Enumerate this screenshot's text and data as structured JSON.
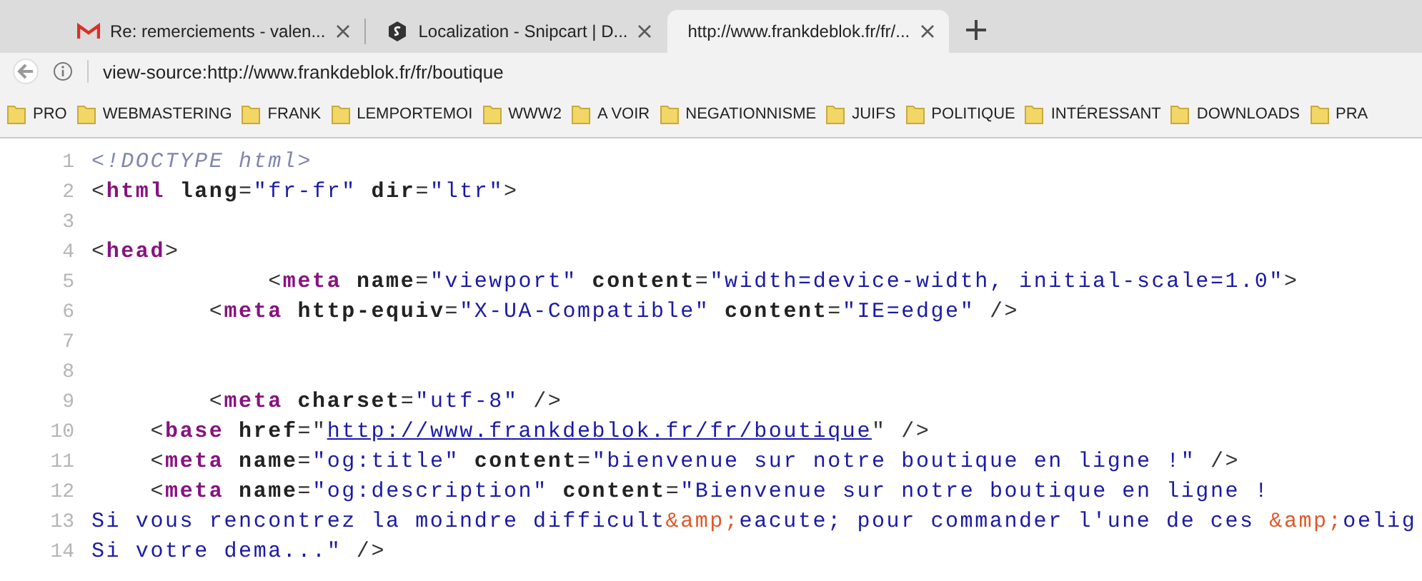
{
  "tabs": [
    {
      "title": "Re: remerciements - valen...",
      "kind": "mail",
      "selected": false
    },
    {
      "title": "Localization - Snipcart | D...",
      "kind": "hexagon",
      "selected": false
    },
    {
      "title": "http://www.frankdeblok.fr/fr/...",
      "kind": "plain",
      "selected": true
    }
  ],
  "address_bar": {
    "url": "view-source:http://www.frankdeblok.fr/fr/boutique"
  },
  "bookmarks": [
    "PRO",
    "WEBMASTERING",
    "FRANK",
    "LEMPORTEMOI",
    "WWW2",
    "A VOIR",
    "NEGATIONNISME",
    "JUIFS",
    "POLITIQUE",
    "INTÉRESSANT",
    "DOWNLOADS",
    "PRA"
  ],
  "source": {
    "lines": [
      {
        "number": "1",
        "tokens": [
          {
            "kind": "comment",
            "text": "<!DOCTYPE html>"
          }
        ]
      },
      {
        "number": "2",
        "tokens": [
          {
            "kind": "punct",
            "text": "<"
          },
          {
            "kind": "tag",
            "text": "html"
          },
          {
            "kind": "attr",
            "text": " lang"
          },
          {
            "kind": "punct",
            "text": "="
          },
          {
            "kind": "value",
            "text": "\"fr-fr\""
          },
          {
            "kind": "attr",
            "text": " dir"
          },
          {
            "kind": "punct",
            "text": "="
          },
          {
            "kind": "value",
            "text": "\"ltr\""
          },
          {
            "kind": "punct",
            "text": ">"
          }
        ]
      },
      {
        "number": "3"
      },
      {
        "number": "4",
        "tokens": [
          {
            "kind": "punct",
            "text": "<"
          },
          {
            "kind": "tag",
            "text": "head"
          },
          {
            "kind": "punct",
            "text": ">"
          }
        ]
      },
      {
        "number": "5",
        "tokens": [
          {
            "kind": "punct",
            "text": "            <"
          },
          {
            "kind": "tag",
            "text": "meta"
          },
          {
            "kind": "attr",
            "text": " name"
          },
          {
            "kind": "punct",
            "text": "="
          },
          {
            "kind": "value",
            "text": "\"viewport\""
          },
          {
            "kind": "attr",
            "text": " content"
          },
          {
            "kind": "punct",
            "text": "="
          },
          {
            "kind": "value",
            "text": "\"width=device-width, initial-scale=1.0\""
          },
          {
            "kind": "punct",
            "text": ">"
          }
        ]
      },
      {
        "number": "6",
        "tokens": [
          {
            "kind": "punct",
            "text": "        <"
          },
          {
            "kind": "tag",
            "text": "meta"
          },
          {
            "kind": "attr",
            "text": " http-equiv"
          },
          {
            "kind": "punct",
            "text": "="
          },
          {
            "kind": "value",
            "text": "\"X-UA-Compatible\""
          },
          {
            "kind": "attr",
            "text": " content"
          },
          {
            "kind": "punct",
            "text": "="
          },
          {
            "kind": "value",
            "text": "\"IE=edge\""
          },
          {
            "kind": "punct",
            "text": " />"
          }
        ]
      },
      {
        "number": "7"
      },
      {
        "number": "8"
      },
      {
        "number": "9",
        "tokens": [
          {
            "kind": "punct",
            "text": "        <"
          },
          {
            "kind": "tag",
            "text": "meta"
          },
          {
            "kind": "attr",
            "text": " charset"
          },
          {
            "kind": "punct",
            "text": "="
          },
          {
            "kind": "value",
            "text": "\"utf-8\""
          },
          {
            "kind": "punct",
            "text": " />"
          }
        ]
      },
      {
        "number": "10",
        "tokens": [
          {
            "kind": "punct",
            "text": "    <"
          },
          {
            "kind": "tag",
            "text": "base"
          },
          {
            "kind": "attr",
            "text": " href"
          },
          {
            "kind": "punct",
            "text": "=\""
          },
          {
            "kind": "link",
            "text": "http://www.frankdeblok.fr/fr/boutique"
          },
          {
            "kind": "punct",
            "text": "\" />"
          }
        ]
      },
      {
        "number": "11",
        "tokens": [
          {
            "kind": "punct",
            "text": "    <"
          },
          {
            "kind": "tag",
            "text": "meta"
          },
          {
            "kind": "attr",
            "text": " name"
          },
          {
            "kind": "punct",
            "text": "="
          },
          {
            "kind": "value",
            "text": "\"og:title\""
          },
          {
            "kind": "attr",
            "text": " content"
          },
          {
            "kind": "punct",
            "text": "="
          },
          {
            "kind": "value",
            "text": "\"bienvenue sur notre boutique en ligne !\""
          },
          {
            "kind": "punct",
            "text": " />"
          }
        ]
      },
      {
        "number": "12",
        "tokens": [
          {
            "kind": "punct",
            "text": "    <"
          },
          {
            "kind": "tag",
            "text": "meta"
          },
          {
            "kind": "attr",
            "text": " name"
          },
          {
            "kind": "punct",
            "text": "="
          },
          {
            "kind": "value",
            "text": "\"og:description\""
          },
          {
            "kind": "attr",
            "text": " content"
          },
          {
            "kind": "punct",
            "text": "="
          },
          {
            "kind": "value",
            "text": "\"Bienvenue sur notre boutique en ligne !"
          }
        ]
      },
      {
        "number": "13",
        "tokens": [
          {
            "kind": "value",
            "text": "Si vous rencontrez la moindre difficult"
          },
          {
            "kind": "entity",
            "text": "&amp;"
          },
          {
            "kind": "value",
            "text": "eacute; pour commander l'une de ces "
          },
          {
            "kind": "entity",
            "text": "&amp;"
          },
          {
            "kind": "value",
            "text": "oelig"
          }
        ]
      },
      {
        "number": "14",
        "tokens": [
          {
            "kind": "value",
            "text": "Si votre dema...\""
          },
          {
            "kind": "punct",
            "text": " />"
          }
        ]
      }
    ]
  }
}
